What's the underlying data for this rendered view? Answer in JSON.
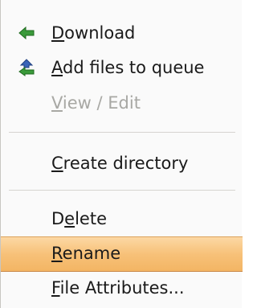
{
  "menu": {
    "items": [
      {
        "id": "download",
        "pre": "",
        "key": "D",
        "post": "ownload",
        "icon": "arrow-left-icon",
        "enabled": true
      },
      {
        "id": "add-files-to-queue",
        "pre": "",
        "key": "A",
        "post": "dd files to queue",
        "icon": "queue-arrows-icon",
        "enabled": true
      },
      {
        "id": "view-edit",
        "pre": "",
        "key": "V",
        "post": "iew / Edit",
        "enabled": false
      },
      {
        "id": "create-directory",
        "pre": "",
        "key": "C",
        "post": "reate directory",
        "enabled": true
      },
      {
        "id": "delete",
        "pre": "D",
        "key": "e",
        "post": "lete",
        "enabled": true
      },
      {
        "id": "rename",
        "pre": "",
        "key": "R",
        "post": "ename",
        "enabled": true,
        "highlighted": true
      },
      {
        "id": "file-attributes",
        "pre": "",
        "key": "F",
        "post": "ile Attributes...",
        "enabled": true
      }
    ]
  },
  "colors": {
    "icon_green": "#3a9a3a",
    "icon_blue": "#3a64b8",
    "highlight": "#f7c179"
  }
}
